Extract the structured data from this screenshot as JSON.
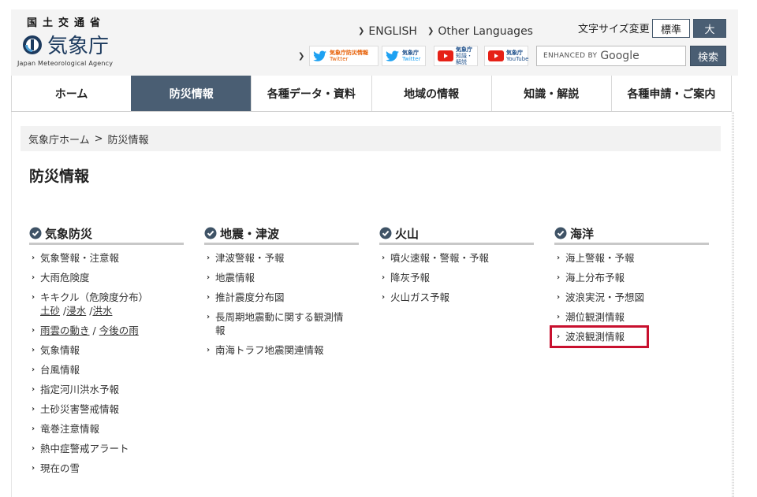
{
  "header": {
    "logo_kanji": "国土交通省",
    "logo_name": "気象庁",
    "logo_en": "Japan Meteorological Agency",
    "lang_english": "ENGLISH",
    "lang_other": "Other Languages",
    "font_size_label": "文字サイズ変更",
    "font_size_normal": "標準",
    "font_size_large": "大",
    "sns": [
      {
        "line1": "気象庁防災情報",
        "line2": "Twitter"
      },
      {
        "line1": "気象庁",
        "line2": "Twitter"
      },
      {
        "line1": "気象庁",
        "line2": "知識・解説"
      },
      {
        "line1": "気象庁",
        "line2": "YouTube"
      }
    ],
    "search_enhanced": "ENHANCED BY",
    "search_google": "Google",
    "search_button": "検索"
  },
  "nav": {
    "items": [
      {
        "label": "ホーム"
      },
      {
        "label": "防災情報"
      },
      {
        "label": "各種データ・資料"
      },
      {
        "label": "地域の情報"
      },
      {
        "label": "知識・解説"
      },
      {
        "label": "各種申請・ご案内"
      }
    ]
  },
  "breadcrumb": {
    "home": "気象庁ホーム",
    "sep": ">",
    "current": "防災情報"
  },
  "page_title": "防災情報",
  "columns": {
    "weather": {
      "title": "気象防災",
      "items": [
        "気象警報・注意報",
        "大雨危険度",
        "キキクル（危険度分布）",
        "雨雲の動き",
        "気象情報",
        "台風情報",
        "指定河川洪水予報",
        "土砂災害警戒情報",
        "竜巻注意情報",
        "熱中症警戒アラート",
        "現在の雪"
      ],
      "kikikuru_sub": [
        "土砂",
        "浸水",
        "洪水"
      ],
      "kikikuru_sep": "/",
      "rain_sep": "/",
      "rain_future": "今後の雨"
    },
    "quake": {
      "title": "地震・津波",
      "items": [
        "津波警報・予報",
        "地震情報",
        "推計震度分布図",
        "長周期地震動に関する観測情報",
        "南海トラフ地震関連情報"
      ]
    },
    "volcano": {
      "title": "火山",
      "items": [
        "噴火速報・警報・予報",
        "降灰予報",
        "火山ガス予報"
      ]
    },
    "ocean": {
      "title": "海洋",
      "items": [
        "海上警報・予報",
        "海上分布予報",
        "波浪実況・予想図",
        "潮位観測情報",
        "波浪観測情報"
      ]
    }
  },
  "colors": {
    "accent": "#4a5e73",
    "highlight": "#c8102e",
    "twitter": "#1da1f2",
    "youtube": "#e62117"
  }
}
